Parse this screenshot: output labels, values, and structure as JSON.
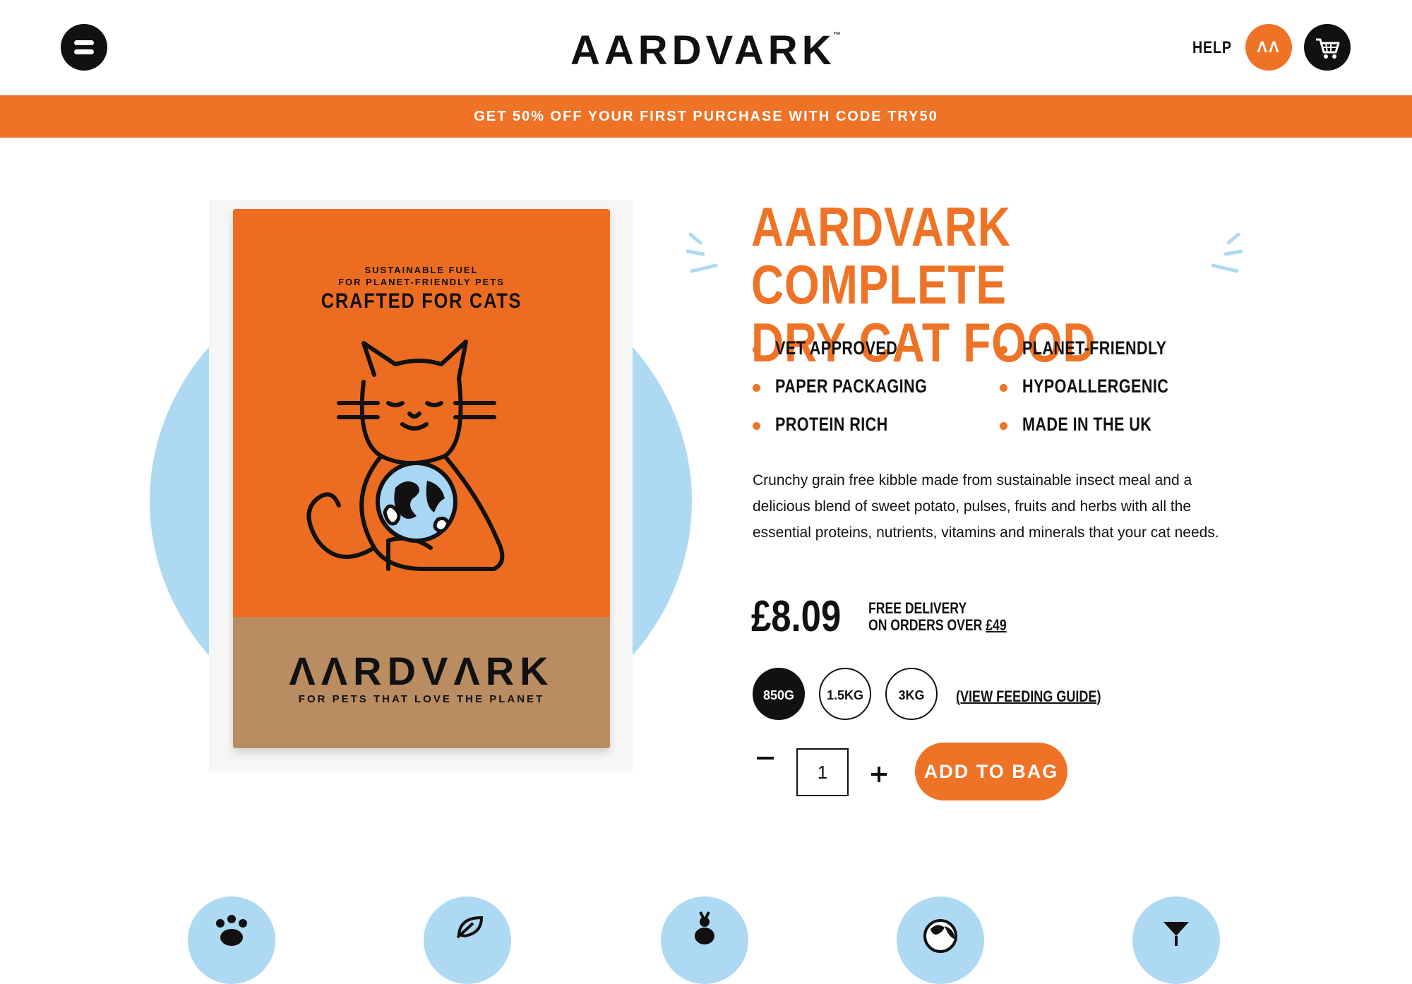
{
  "header": {
    "menu_icon": "menu-icon",
    "logo": "AARDVARK",
    "logo_tm": "™",
    "help_label": "HELP",
    "account_label": "ΛΛ",
    "cart_icon": "cart-icon"
  },
  "promo": {
    "text": "GET 50% OFF YOUR FIRST PURCHASE WITH CODE TRY50"
  },
  "product_image": {
    "bag_fuel_line1": "SUSTAINABLE FUEL",
    "bag_fuel_line2": "FOR PLANET-FRIENDLY PETS",
    "bag_crafted": "CRAFTED FOR CATS",
    "bag_logo": "ΛΛRDVΛRK",
    "bag_tagline": "FOR PETS THAT LOVE THE PLANET"
  },
  "product": {
    "title_line1": "AARDVARK COMPLETE",
    "title_line2": "DRY CAT FOOD",
    "features": [
      "VET APPROVED",
      "PLANET-FRIENDLY",
      "PAPER PACKAGING",
      "HYPOALLERGENIC",
      "PROTEIN RICH",
      "MADE IN THE UK"
    ],
    "description": "Crunchy grain free kibble made from sustainable insect meal and a delicious blend of sweet potato, pulses, fruits and herbs with all the essential proteins, nutrients, vitamins and minerals that your cat needs.",
    "price": "£8.09",
    "delivery_line1": "FREE DELIVERY",
    "delivery_line2_prefix": "ON ORDERS OVER",
    "delivery_threshold": "£49",
    "sizes": [
      "850G",
      "1.5KG",
      "3KG"
    ],
    "selected_size": "850G",
    "feeding_guide": "(VIEW FEEDING GUIDE)",
    "quantity": "1",
    "add_to_bag": "ADD TO BAG"
  },
  "benefit_icons": [
    "paw-icon",
    "leaf-icon",
    "insect-icon",
    "globe-icon",
    "heart-icon"
  ],
  "colors": {
    "accent": "#ee7326",
    "blob": "#add9f3",
    "dark": "#111111",
    "kraft": "#b98c62"
  }
}
